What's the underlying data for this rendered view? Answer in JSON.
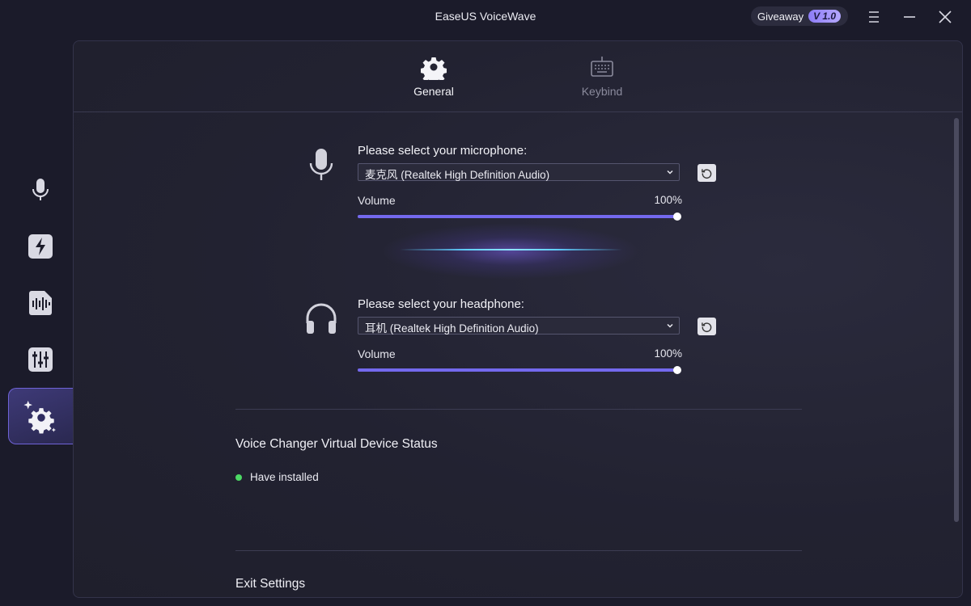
{
  "app": {
    "title": "EaseUS VoiceWave",
    "giveaway_label": "Giveaway",
    "version": "V 1.0"
  },
  "window_controls": {
    "menu_icon": "hamburger-icon",
    "minimize_icon": "minimize-icon",
    "close_icon": "close-icon"
  },
  "sidebar": {
    "items": [
      {
        "name": "microphone",
        "icon": "microphone-icon",
        "active": false
      },
      {
        "name": "soundboard",
        "icon": "lightning-icon",
        "active": false
      },
      {
        "name": "audio-files",
        "icon": "sound-file-icon",
        "active": false
      },
      {
        "name": "mixer",
        "icon": "equalizer-icon",
        "active": false
      },
      {
        "name": "settings",
        "icon": "settings-sparkle-icon",
        "active": true
      }
    ]
  },
  "tabs": [
    {
      "label": "General",
      "icon": "gear-icon",
      "active": true
    },
    {
      "label": "Keybind",
      "icon": "keyboard-icon",
      "active": false
    }
  ],
  "microphone": {
    "label": "Please select your microphone:",
    "selected": "麦克风 (Realtek High Definition Audio)",
    "volume_label": "Volume",
    "volume_value": "100%",
    "volume_percent": 100
  },
  "headphone": {
    "label": "Please select your headphone:",
    "selected": "耳机 (Realtek High Definition Audio)",
    "volume_label": "Volume",
    "volume_value": "100%",
    "volume_percent": 100
  },
  "virtual_device": {
    "title": "Voice Changer Virtual Device Status",
    "status": "Have installed",
    "status_color": "#4cd964"
  },
  "exit_settings": {
    "title": "Exit Settings"
  },
  "colors": {
    "accent": "#7469ee",
    "background": "#1b1b2a"
  }
}
